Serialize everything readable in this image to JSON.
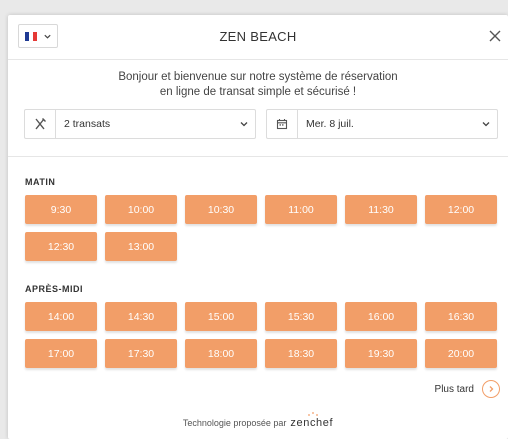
{
  "header": {
    "title": "ZEN BEACH",
    "flag_colors": [
      "#1f3a93",
      "#ffffff",
      "#e53935"
    ]
  },
  "welcome": {
    "line1": "Bonjour et bienvenue sur notre système de réservation",
    "line2": "en ligne de transat simple et sécurisé !"
  },
  "selectors": {
    "guests": {
      "icon": "utensils-icon",
      "value": "2 transats"
    },
    "date": {
      "icon": "calendar-icon",
      "value": "Mer. 8 juil."
    }
  },
  "morning": {
    "label": "MATIN",
    "slots": [
      "9:30",
      "10:00",
      "10:30",
      "11:00",
      "11:30",
      "12:00",
      "12:30",
      "13:00"
    ]
  },
  "afternoon": {
    "label": "APRÈS-MIDI",
    "slots": [
      "14:00",
      "14:30",
      "15:00",
      "15:30",
      "16:00",
      "16:30",
      "17:00",
      "17:30",
      "18:00",
      "18:30",
      "19:30",
      "20:00"
    ]
  },
  "later": {
    "label": "Plus tard"
  },
  "footer": {
    "text": "Technologie proposée par",
    "brand": "zenchef"
  },
  "colors": {
    "slot": "#f29e68",
    "brand_accent": "#f29e68"
  }
}
